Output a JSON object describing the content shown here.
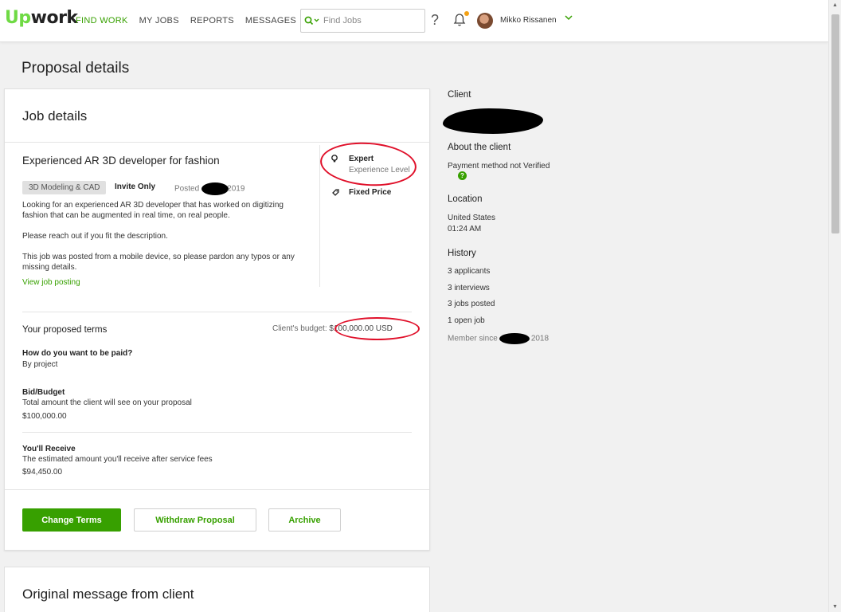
{
  "header": {
    "logo_up": "Up",
    "logo_work": "work",
    "nav": [
      {
        "label": "FIND WORK"
      },
      {
        "label": "MY JOBS"
      },
      {
        "label": "REPORTS"
      },
      {
        "label": "MESSAGES"
      }
    ],
    "search_placeholder": "Find Jobs",
    "help": "?",
    "username": "Mikko Rissanen",
    "accent_color": "#37a000",
    "notification_dot_color": "#f3a115"
  },
  "page": {
    "title": "Proposal details"
  },
  "job_details": {
    "card_title": "Job details",
    "job_title": "Experienced AR 3D developer for fashion",
    "tag": "3D Modeling & CAD",
    "invite": "Invite Only",
    "posted_label": "Posted",
    "posted_year": "2019",
    "description": [
      "Looking for an experienced AR 3D developer that has worked on digitizing fashion that can be augmented in real time, on real people.",
      "Please reach out if you fit the description.",
      "This job was posted from a mobile device, so please pardon any typos or any missing details."
    ],
    "view_link": "View job posting",
    "experience_label": "Expert",
    "experience_sub": "Experience Level",
    "price_type": "Fixed Price"
  },
  "terms": {
    "title": "Your proposed terms",
    "budget_label": "Client's budget:",
    "budget_amount": "$100,000.00 USD",
    "paid_label": "How do you want to be paid?",
    "paid_value": "By project",
    "bid_label": "Bid/Budget",
    "bid_help": "Total amount the client will see on your proposal",
    "bid_value": "$100,000.00",
    "receive_label": "You'll Receive",
    "receive_help": "The estimated amount you'll receive after service fees",
    "receive_value": "$94,450.00"
  },
  "actions": {
    "change": "Change Terms",
    "withdraw": "Withdraw Proposal",
    "archive": "Archive"
  },
  "original_message": {
    "title": "Original message from client"
  },
  "client": {
    "heading": "Client",
    "about_heading": "About the client",
    "payment": "Payment method not Verified",
    "location_heading": "Location",
    "country": "United States",
    "time": "01:24 AM",
    "history_heading": "History",
    "applicants": "3 applicants",
    "interviews": "3 interviews",
    "jobs_posted": "3 jobs posted",
    "open_jobs": "1 open job",
    "member_label": "Member since",
    "member_year": "2018"
  }
}
